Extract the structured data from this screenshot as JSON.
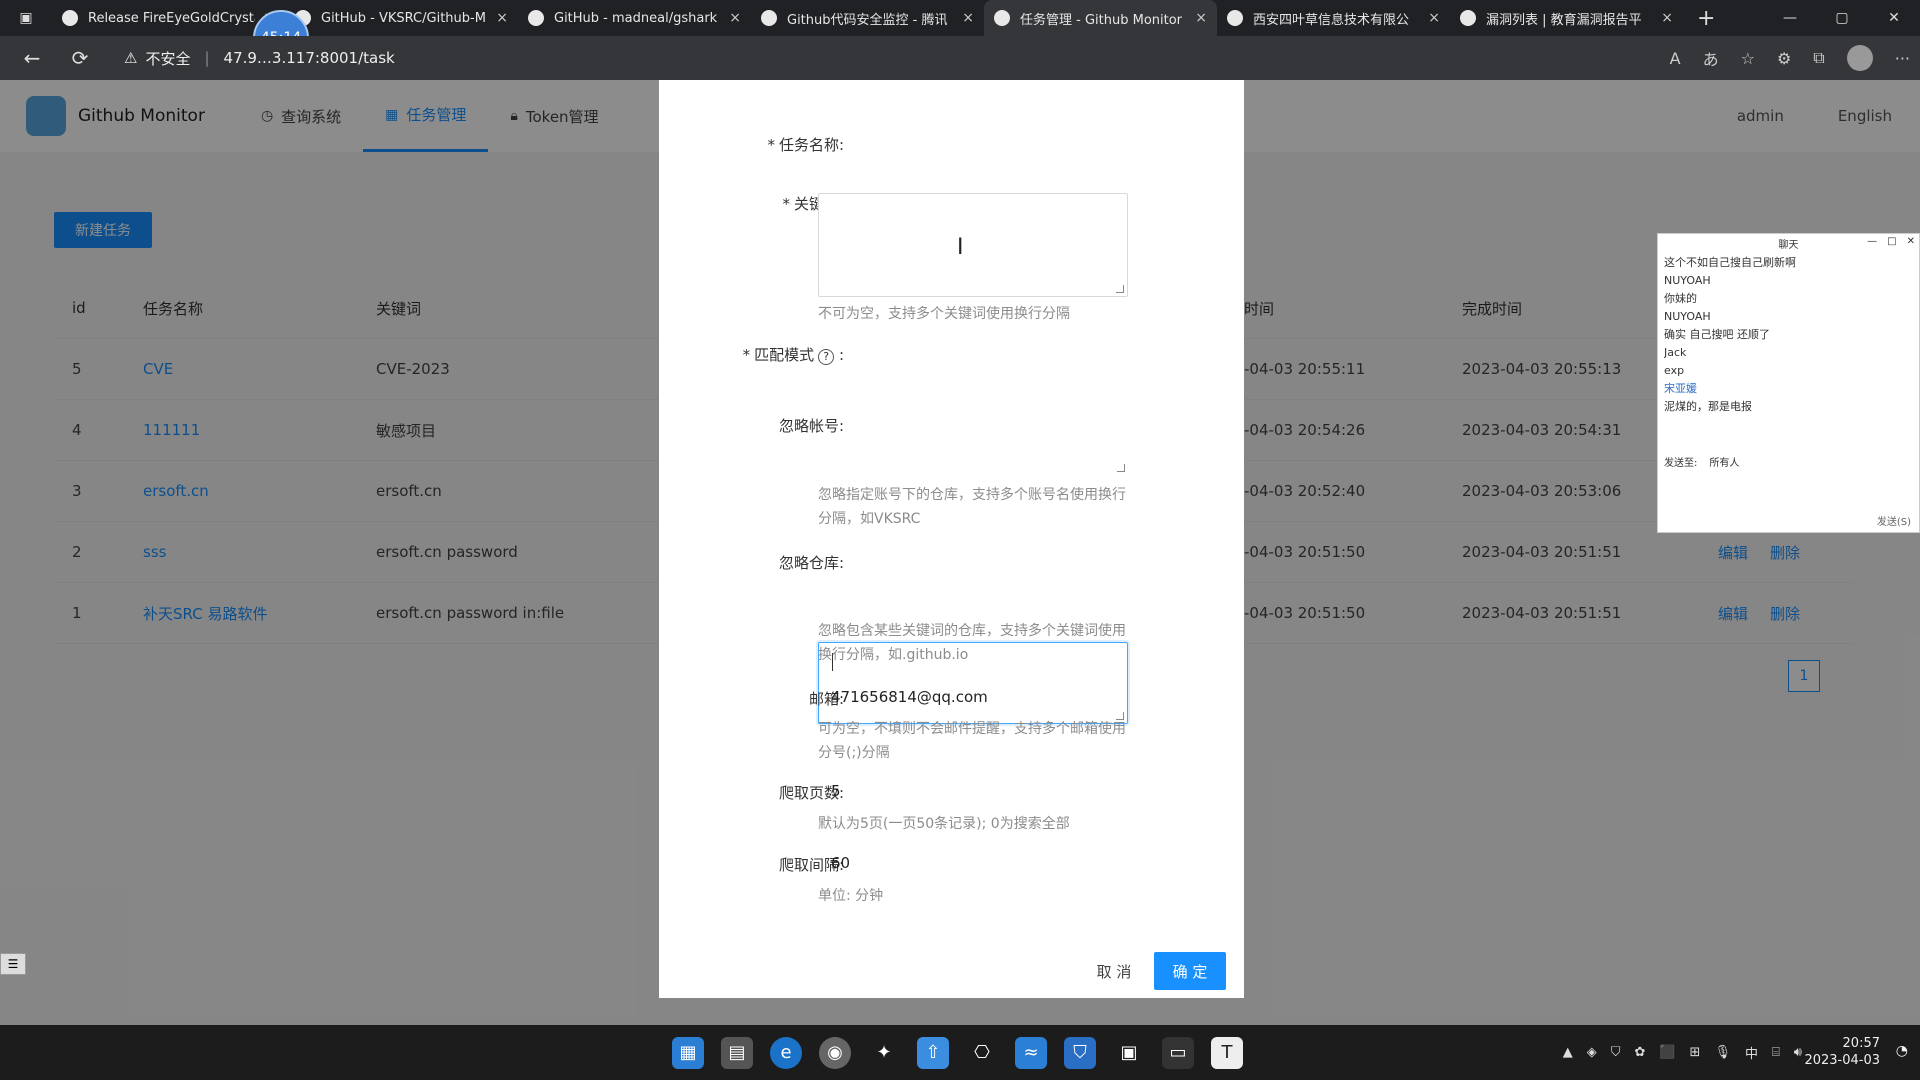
{
  "browser": {
    "tabs": [
      {
        "title": "Release FireEyeGoldCrysta",
        "active": false
      },
      {
        "title": "GitHub - VKSRC/Github-M",
        "active": false
      },
      {
        "title": "GitHub - madneal/gshark",
        "active": false
      },
      {
        "title": "Github代码安全监控 - 腾讯",
        "active": false
      },
      {
        "title": "任务管理 - Github Monitor",
        "active": true
      },
      {
        "title": "西安四叶草信息技术有限公",
        "active": false
      },
      {
        "title": "漏洞列表 | 教育漏洞报告平",
        "active": false
      }
    ],
    "recording_badge": "45:14",
    "security_label": "不安全",
    "url": "47.9…3.117:8001/task",
    "tab_close": "×",
    "new_tab": "+"
  },
  "app": {
    "name": "Github Monitor",
    "menu": [
      {
        "label": "查询系统",
        "active": false
      },
      {
        "label": "任务管理",
        "active": true
      },
      {
        "label": "Token管理",
        "active": false
      }
    ],
    "user": "admin",
    "language": "English",
    "new_task_button": "新建任务"
  },
  "table": {
    "headers": {
      "id": "id",
      "name": "任务名称",
      "keywords": "关键词",
      "create_time": "时间",
      "finish_time": "完成时间"
    },
    "rows": [
      {
        "id": "5",
        "name": "CVE",
        "keywords": "CVE-2023",
        "create_time": "-04-03 20:55:11",
        "finish_time": "2023-04-03 20:55:13",
        "edit": "",
        "delete": ""
      },
      {
        "id": "4",
        "name": "111111",
        "keywords": "敏感项目",
        "create_time": "-04-03 20:54:26",
        "finish_time": "2023-04-03 20:54:31",
        "edit": "",
        "delete": ""
      },
      {
        "id": "3",
        "name": "ersoft.cn",
        "keywords": "ersoft.cn",
        "create_time": "-04-03 20:52:40",
        "finish_time": "2023-04-03 20:53:06",
        "edit": "",
        "delete": ""
      },
      {
        "id": "2",
        "name": "sss",
        "keywords": "ersoft.cn password",
        "create_time": "-04-03 20:51:50",
        "finish_time": "2023-04-03 20:51:51",
        "edit": "编辑",
        "delete": "删除"
      },
      {
        "id": "1",
        "name": "补天SRC 易路软件",
        "keywords": "ersoft.cn password in:file",
        "create_time": "-04-03 20:51:50",
        "finish_time": "2023-04-03 20:51:51",
        "edit": "编辑",
        "delete": "删除"
      }
    ],
    "page": "1"
  },
  "modal": {
    "task_name_label": "任务名称:",
    "keywords_label": "关键词:",
    "keywords_help": "不可为空，支持多个关键词使用换行分隔",
    "match_mode_label": "匹配模式",
    "match_mode_hint": "?",
    "ignore_account_label": "忽略帐号:",
    "ignore_account_help": "忽略指定账号下的仓库，支持多个账号名使用换行分隔，如VKSRC",
    "ignore_repo_label": "忽略仓库:",
    "ignore_repo_help": "忽略包含某些关键词的仓库，支持多个关键词使用换行分隔，如.github.io",
    "email_label": "邮箱:",
    "email_value": "471656814@qq.com",
    "email_help": "可为空，不填则不会邮件提醒，支持多个邮箱使用分号(;)分隔",
    "pages_label": "爬取页数:",
    "pages_value": "5",
    "pages_help": "默认为5页(一页50条记录); 0为搜索全部",
    "interval_label": "爬取间隔:",
    "interval_value": "60",
    "interval_help": "单位: 分钟",
    "cancel": "取 消",
    "ok": "确 定"
  },
  "chat": {
    "title": "聊天",
    "messages": [
      {
        "text": "这个不如自己搜自己刷新啊",
        "style": "normal"
      },
      {
        "text": "NUYOAH",
        "style": "name"
      },
      {
        "text": "你妹的",
        "style": "normal"
      },
      {
        "text": "NUYOAH",
        "style": "name"
      },
      {
        "text": "确实 自己搜吧 还顺了",
        "style": "normal"
      },
      {
        "text": "Jack",
        "style": "name"
      },
      {
        "text": "exp",
        "style": "normal"
      },
      {
        "text": "宋亚媛",
        "style": "blue"
      },
      {
        "text": "泥煤的，那是电报",
        "style": "normal"
      }
    ],
    "send_to_label": "发送至:",
    "send_to_value": "所有人",
    "send_button": "发送(S)"
  },
  "taskbar": {
    "time": "20:57",
    "date": "2023-04-03",
    "ime": "中"
  }
}
